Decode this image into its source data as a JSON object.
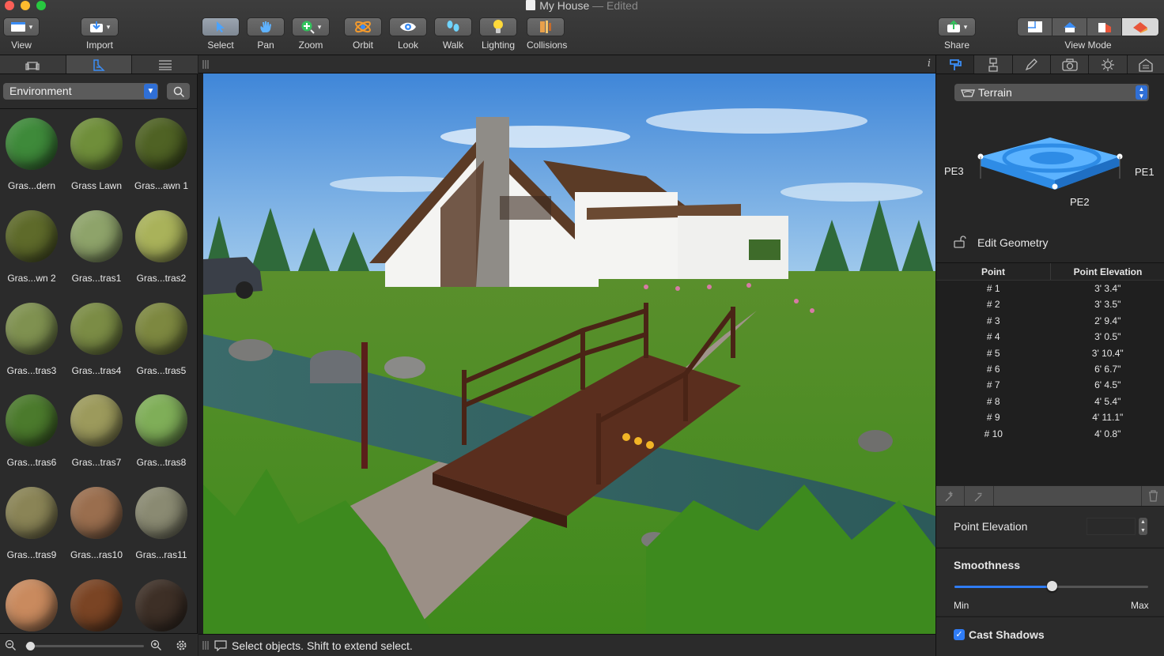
{
  "window": {
    "title": "My House",
    "edited": "— Edited",
    "traffic": [
      "#fc5f57",
      "#fdbc2e",
      "#28c840"
    ]
  },
  "toolbar": {
    "view": "View",
    "import": "Import",
    "select": "Select",
    "pan": "Pan",
    "zoom": "Zoom",
    "orbit": "Orbit",
    "look": "Look",
    "walk": "Walk",
    "lighting": "Lighting",
    "collisions": "Collisions",
    "share": "Share",
    "view_mode": "View Mode"
  },
  "library": {
    "category": "Environment",
    "materials": [
      {
        "name": "Gras...dern",
        "color": "#3e8a3a"
      },
      {
        "name": "Grass Lawn",
        "color": "#6f8e3a"
      },
      {
        "name": "Gras...awn 1",
        "color": "#4f6224"
      },
      {
        "name": "Gras...wn 2",
        "color": "#5e6a2a"
      },
      {
        "name": "Gras...tras1",
        "color": "#8ea36a"
      },
      {
        "name": "Gras...tras2",
        "color": "#a9b25a"
      },
      {
        "name": "Gras...tras3",
        "color": "#7f9150"
      },
      {
        "name": "Gras...tras4",
        "color": "#7b8c45"
      },
      {
        "name": "Gras...tras5",
        "color": "#7d8840"
      },
      {
        "name": "Gras...tras6",
        "color": "#4b7a2c"
      },
      {
        "name": "Gras...tras7",
        "color": "#9c9a5c"
      },
      {
        "name": "Gras...tras8",
        "color": "#7fae58"
      },
      {
        "name": "Gras...tras9",
        "color": "#8a8456"
      },
      {
        "name": "Gras...ras10",
        "color": "#9a6e4e"
      },
      {
        "name": "Gras...ras11",
        "color": "#8a8a72"
      },
      {
        "name": "",
        "color": "#c98a5e"
      },
      {
        "name": "",
        "color": "#7a4424"
      },
      {
        "name": "",
        "color": "#3d2f26"
      }
    ],
    "zoom_level": 0.02
  },
  "status": {
    "text": "Select objects. Shift to extend select."
  },
  "inspector": {
    "terrain_label": "Terrain",
    "pe_labels": [
      "PE3",
      "PE1",
      "PE2"
    ],
    "edit_geometry": "Edit Geometry",
    "columns": [
      "Point",
      "Point Elevation"
    ],
    "points": [
      {
        "point": "# 1",
        "elevation": "3' 3.4\""
      },
      {
        "point": "# 2",
        "elevation": "3' 3.5\""
      },
      {
        "point": "# 3",
        "elevation": "2' 9.4\""
      },
      {
        "point": "# 4",
        "elevation": "3' 0.5\""
      },
      {
        "point": "# 5",
        "elevation": "3' 10.4\""
      },
      {
        "point": "# 6",
        "elevation": "6' 6.7\""
      },
      {
        "point": "# 7",
        "elevation": "6' 4.5\""
      },
      {
        "point": "# 8",
        "elevation": "4' 5.4\""
      },
      {
        "point": "# 9",
        "elevation": "4' 11.1\""
      },
      {
        "point": "# 10",
        "elevation": "4' 0.8\""
      }
    ],
    "point_elevation_label": "Point Elevation",
    "smoothness_label": "Smoothness",
    "smoothness_value": 0.5,
    "min_label": "Min",
    "max_label": "Max",
    "cast_shadows_label": "Cast Shadows",
    "cast_shadows_checked": true
  }
}
